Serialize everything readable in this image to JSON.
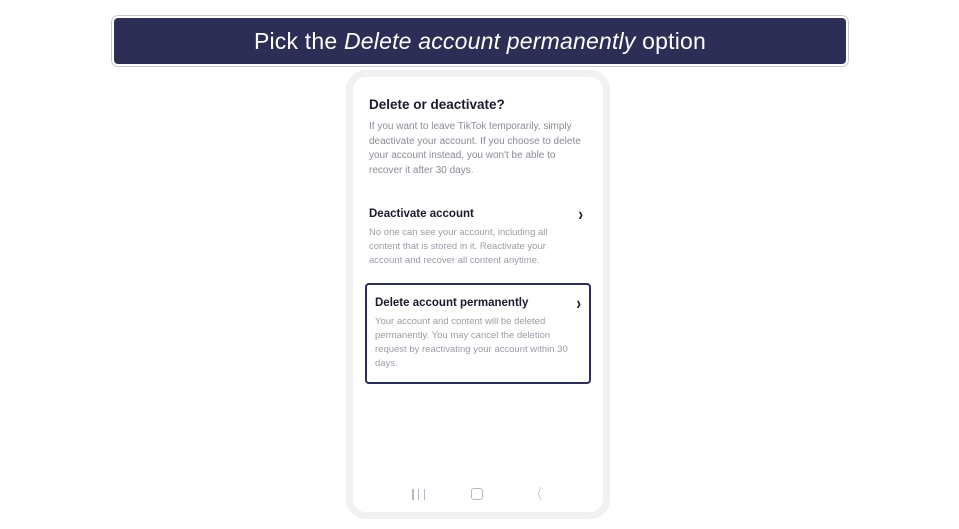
{
  "banner": {
    "prefix": "Pick the ",
    "italic": "Delete account permanently",
    "suffix": " option"
  },
  "screen": {
    "title": "Delete or deactivate?",
    "intro": "If you want to leave TikTok temporarily, simply deactivate your account. If you choose to delete your account instead, you won't be able to recover it after 30 days.",
    "deactivate": {
      "title": "Deactivate account",
      "desc": "No one can see your account, including all content that is stored in it. Reactivate your account and recover all content anytime."
    },
    "delete": {
      "title": "Delete account permanently",
      "desc": "Your account and content will be deleted permanently. You may cancel the deletion request by reactivating your account within 30 days."
    }
  }
}
